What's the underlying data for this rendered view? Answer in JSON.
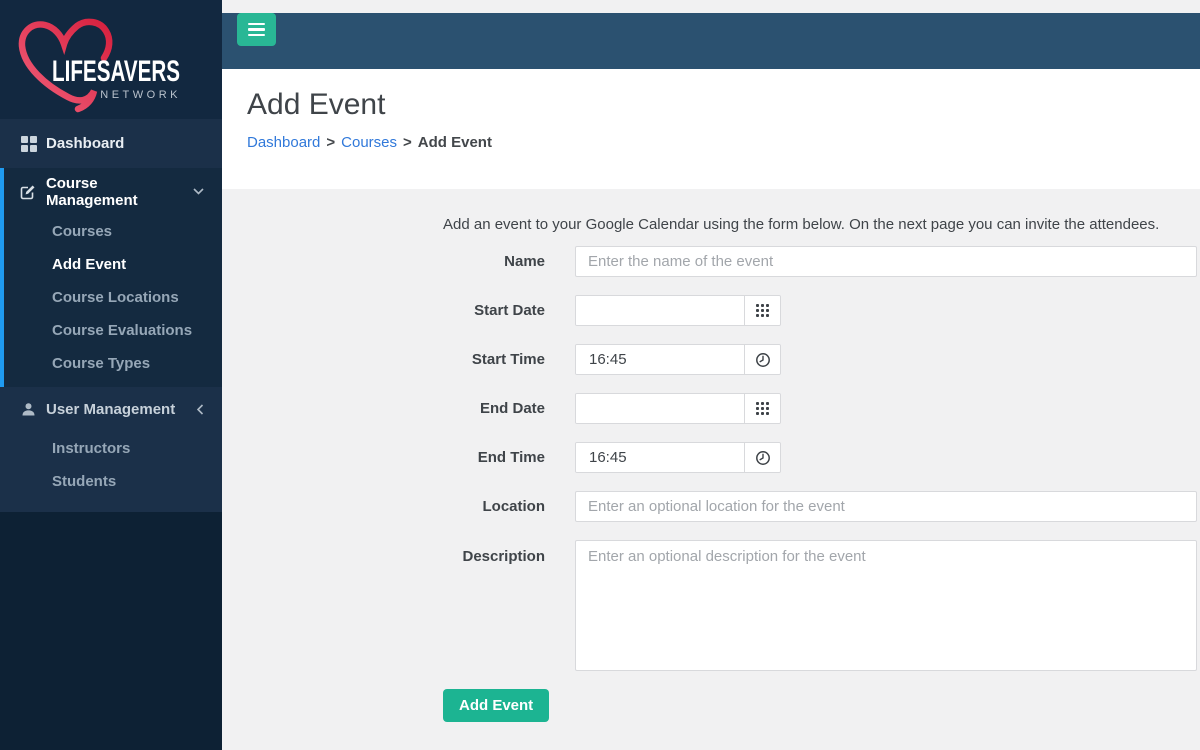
{
  "colors": {
    "sidebar_base": "#0d2134",
    "sidebar_highlight": "#1b3049",
    "active_border_blue": "#1f9bf1",
    "topbar": "#2b5170",
    "accent_green": "#1cb492",
    "link_blue": "#3179da",
    "heart_red": "#d6203e",
    "heart_pink": "#f2607b"
  },
  "sidebar": {
    "logo_title": "LIFESAVERS",
    "logo_subtitle": "NETWORK",
    "dashboard_label": "Dashboard",
    "course": {
      "label": "Course Management",
      "chevron": "down",
      "items": [
        "Courses",
        "Add Event",
        "Course Locations",
        "Course Evaluations",
        "Course Types"
      ],
      "active_item": "Add Event"
    },
    "user": {
      "label": "User Management",
      "chevron": "left",
      "items": [
        "Instructors",
        "Students"
      ]
    }
  },
  "header": {
    "title": "Add Event",
    "breadcrumb": {
      "items": [
        "Dashboard",
        "Courses",
        "Add Event"
      ],
      "separator": ">"
    }
  },
  "form": {
    "intro": "Add an event to your Google Calendar using the form below. On the next page you can invite the attendees.",
    "fields": {
      "name": {
        "label": "Name",
        "placeholder": "Enter the name of the event",
        "value": ""
      },
      "start_date": {
        "label": "Start Date",
        "value": "",
        "icon": "calendar-grid-icon"
      },
      "start_time": {
        "label": "Start Time",
        "value": "16:45",
        "icon": "clock-icon"
      },
      "end_date": {
        "label": "End Date",
        "value": "",
        "icon": "calendar-grid-icon"
      },
      "end_time": {
        "label": "End Time",
        "value": "16:45",
        "icon": "clock-icon"
      },
      "location": {
        "label": "Location",
        "placeholder": "Enter an optional location for the event",
        "value": ""
      },
      "description": {
        "label": "Description",
        "placeholder": "Enter an optional description for the event",
        "value": ""
      }
    },
    "submit_label": "Add Event"
  }
}
